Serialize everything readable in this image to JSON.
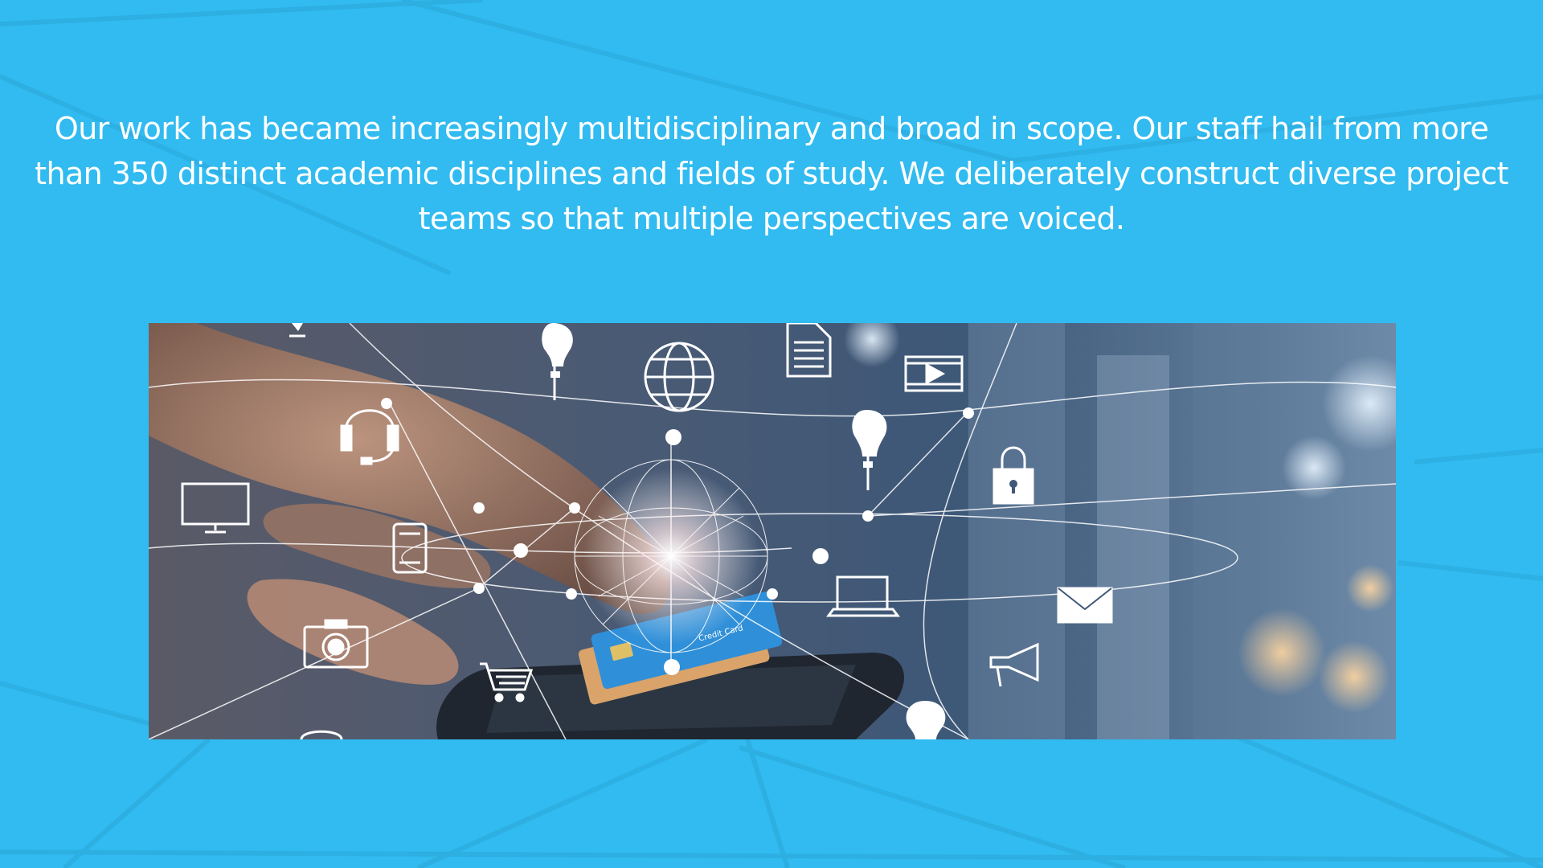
{
  "slide": {
    "background_color": "#31bbf0",
    "body_text": "Our work has became increasingly multidisciplinary and broad in scope. Our staff hail from more than 350 distinct academic disciplines and fields of study. We deliberately construct diverse project teams so that multiple perspectives are voiced.",
    "image": {
      "description_icon": "network-technology-photo",
      "card_text": "Credit Card",
      "icons": [
        "hourglass-icon",
        "lightbulb-icon",
        "globe-icon",
        "document-icon",
        "video-icon",
        "headset-icon",
        "lightbulb-icon",
        "padlock-icon",
        "monitor-icon",
        "smartphone-icon",
        "laptop-icon",
        "envelope-icon",
        "camera-icon",
        "shopping-cart-icon",
        "megaphone-icon",
        "lightbulb-icon"
      ]
    }
  }
}
